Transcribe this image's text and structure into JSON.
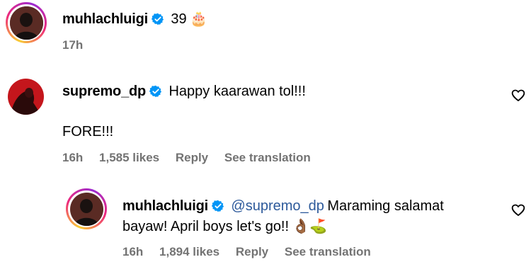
{
  "post": {
    "username": "muhlachluigi",
    "caption": "39",
    "caption_emoji": "🎂",
    "time": "17h"
  },
  "comment": {
    "username": "supremo_dp",
    "text_line1": "Happy kaarawan tol!!!",
    "text_line2": "FORE!!!",
    "time": "16h",
    "likes": "1,585 likes",
    "reply_label": "Reply",
    "translate_label": "See translation"
  },
  "reply": {
    "username": "muhlachluigi",
    "mention": "@supremo_dp",
    "text_line1": "Maraming salamat",
    "text_line2": "bayaw! April boys let's go!!",
    "emojis": "👌🏾⛳",
    "time": "16h",
    "likes": "1,894 likes",
    "reply_label": "Reply",
    "translate_label": "See translation"
  },
  "colors": {
    "verified": "#0095f6",
    "meta": "#737373",
    "mention": "#2d5a9b"
  }
}
